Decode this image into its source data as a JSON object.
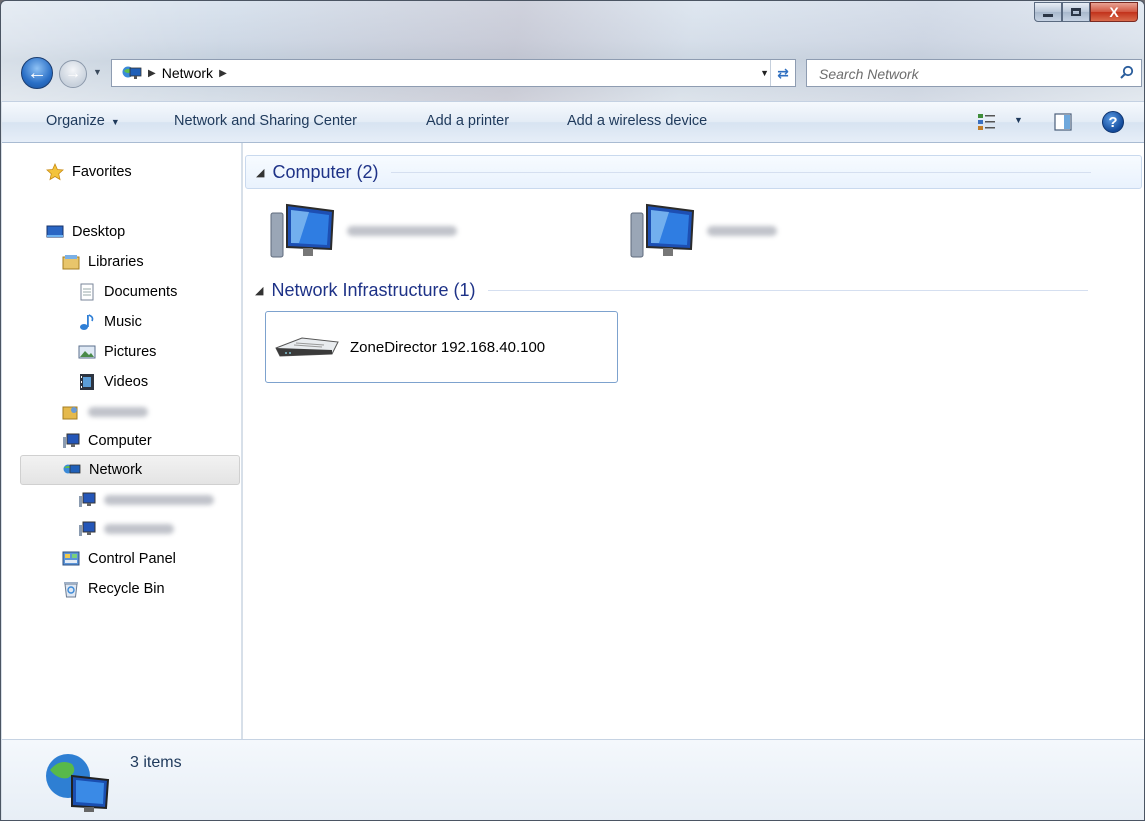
{
  "window": {
    "close_label": "X"
  },
  "address": {
    "location": "Network",
    "search_placeholder": "Search Network"
  },
  "toolbar": {
    "organize": "Organize",
    "network_sharing": "Network and Sharing Center",
    "add_printer": "Add a printer",
    "add_wireless": "Add a wireless device",
    "help_label": "?"
  },
  "nav": {
    "favorites": "Favorites",
    "desktop": "Desktop",
    "libraries": "Libraries",
    "documents": "Documents",
    "music": "Music",
    "pictures": "Pictures",
    "videos": "Videos",
    "computer": "Computer",
    "network": "Network",
    "control_panel": "Control Panel",
    "recycle_bin": "Recycle Bin"
  },
  "groups": [
    {
      "title": "Computer (2)"
    },
    {
      "title": "Network Infrastructure (1)"
    }
  ],
  "devices": {
    "zonedirector": "ZoneDirector 192.168.40.100"
  },
  "status": {
    "item_count": "3 items"
  },
  "colors": {
    "group_header_text": "#1e3287",
    "command_text": "#1e395b",
    "selection_border": "#7da2ce"
  }
}
